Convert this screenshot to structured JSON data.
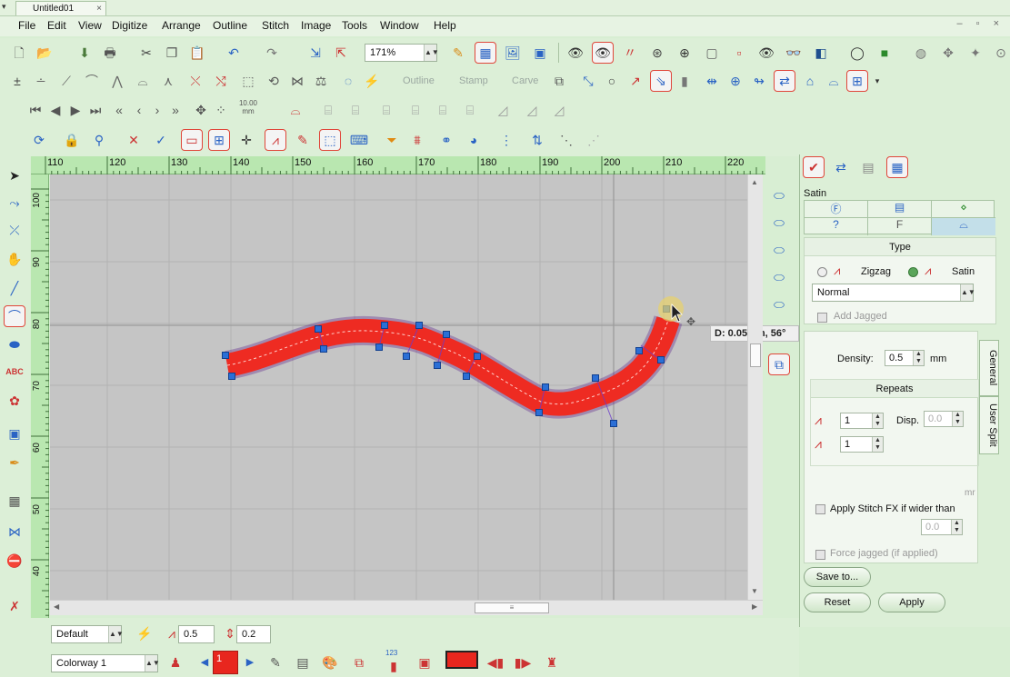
{
  "window": {
    "sys_menu": "▾",
    "doc_tab": "Untitled01",
    "doc_tab_close": "×",
    "controls": "‒ ▫ ×"
  },
  "menu": [
    "File",
    "Edit",
    "View",
    "Digitize",
    "Arrange",
    "Outline",
    "Stitch",
    "Image",
    "Tools",
    "Window",
    "Help"
  ],
  "toolbar1": {
    "zoom_value": "171%"
  },
  "toolbar2": {
    "outline_label": "Outline",
    "stamp_label": "Stamp",
    "carve_label": "Carve"
  },
  "toolbar3": {
    "step_value": "10.00",
    "step_unit": "mm"
  },
  "ruler": {
    "top": [
      "110",
      "120",
      "130",
      "140",
      "150",
      "160",
      "170",
      "180",
      "190",
      "200",
      "210",
      "220"
    ],
    "left": [
      "100",
      "90",
      "80",
      "70",
      "60",
      "50",
      "40"
    ]
  },
  "canvas": {
    "bg_color": "#c5c5c5",
    "stitch_color": "#ee2b22",
    "node_color": "#2b6fd6"
  },
  "tooltip": {
    "text": "D: 0.05mm, 56°"
  },
  "panel": {
    "object_type": "Satin",
    "type_group": {
      "heading": "Type",
      "option_zigzag": "Zigzag",
      "option_satin": "Satin",
      "selected": "Satin",
      "style_value": "Normal",
      "add_jagged": "Add Jagged"
    },
    "density": {
      "label": "Density:",
      "value": "0.5",
      "unit": "mm"
    },
    "repeats": {
      "heading": "Repeats",
      "count1": "1",
      "count2": "1",
      "disp_label": "Disp.",
      "disp_value": "0.0"
    },
    "unit_tail": "mr",
    "apply_fx": "Apply Stitch FX if wider than",
    "fx_value": "0.0",
    "force_jagged": "Force jagged (if applied)",
    "tabs_vertical": [
      "General",
      "User Split"
    ],
    "save_button": "Save to...",
    "reset_button": "Reset",
    "apply_button": "Apply"
  },
  "status": {
    "style_value": "Default",
    "density_value": "0.5",
    "length_value": "0.2",
    "colorway_value": "Colorway 1",
    "color_index": "1",
    "color_swatch": "#e8261e",
    "sequence_badge": "123"
  }
}
